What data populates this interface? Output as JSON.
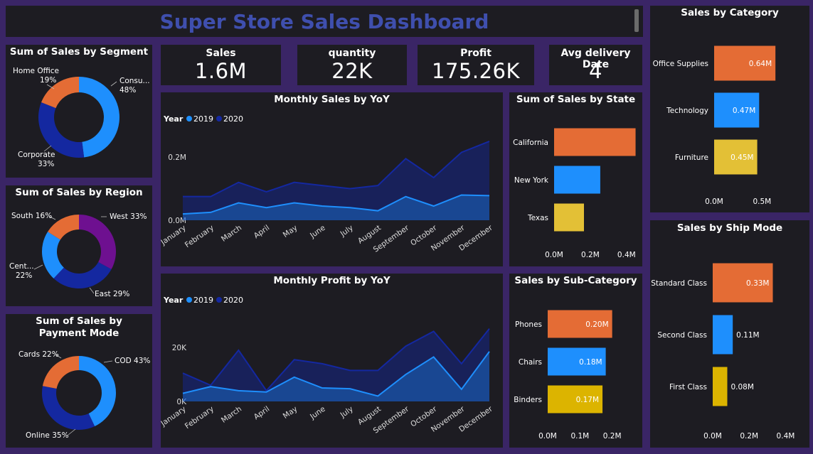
{
  "dashboard": {
    "title": "Super Store Sales Dashboard"
  },
  "kpis": [
    {
      "label": "Sales",
      "value": "1.6M"
    },
    {
      "label": "quantity",
      "value": "22K"
    },
    {
      "label": "Profit",
      "value": "175.26K"
    },
    {
      "label": "Avg delivery Date",
      "value": "4"
    }
  ],
  "colors": {
    "blue": "#1e8ffd",
    "darkblue": "#1428a0",
    "orange": "#e46c35",
    "purple": "#6e1090",
    "yellow": "#e3c036",
    "gold": "#dcb400"
  },
  "chart_data": [
    {
      "id": "segment",
      "type": "pie",
      "title": "Sum of Sales by Segment",
      "slices": [
        {
          "label": "Consu...",
          "pct": "48%",
          "value": 48,
          "color": "#1e8ffd"
        },
        {
          "label": "Corporate",
          "pct": "33%",
          "value": 33,
          "color": "#1428a0"
        },
        {
          "label": "Home Office",
          "pct": "19%",
          "value": 19,
          "color": "#e46c35"
        }
      ]
    },
    {
      "id": "region",
      "type": "pie",
      "title": "Sum of Sales by Region",
      "slices": [
        {
          "label": "West",
          "pct": "33%",
          "value": 33,
          "color": "#6e1090"
        },
        {
          "label": "East",
          "pct": "29%",
          "value": 29,
          "color": "#1428a0"
        },
        {
          "label": "Cent...",
          "pct": "22%",
          "value": 22,
          "color": "#1e8ffd"
        },
        {
          "label": "South",
          "pct": "16%",
          "value": 16,
          "color": "#e46c35"
        }
      ]
    },
    {
      "id": "payment",
      "type": "pie",
      "title": "Sum of Sales by Payment Mode",
      "slices": [
        {
          "label": "COD",
          "pct": "43%",
          "value": 43,
          "color": "#1e8ffd"
        },
        {
          "label": "Online",
          "pct": "35%",
          "value": 35,
          "color": "#1428a0"
        },
        {
          "label": "Cards",
          "pct": "22%",
          "value": 22,
          "color": "#e46c35"
        }
      ]
    },
    {
      "id": "monthly_sales",
      "type": "area",
      "title": "Monthly Sales by YoY",
      "legend_title": "Year",
      "categories": [
        "January",
        "February",
        "March",
        "April",
        "May",
        "June",
        "July",
        "August",
        "September",
        "October",
        "November",
        "December"
      ],
      "series": [
        {
          "name": "2020",
          "color": "#1428a0",
          "values": [
            0.075,
            0.075,
            0.12,
            0.09,
            0.12,
            0.11,
            0.1,
            0.11,
            0.195,
            0.135,
            0.215,
            0.25
          ]
        },
        {
          "name": "2019",
          "color": "#1e8ffd",
          "values": [
            0.02,
            0.025,
            0.055,
            0.04,
            0.055,
            0.045,
            0.04,
            0.03,
            0.075,
            0.045,
            0.08,
            0.078
          ]
        }
      ],
      "yticks": [
        {
          "v": 0,
          "label": "0.0M"
        },
        {
          "v": 0.2,
          "label": "0.2M"
        }
      ],
      "ylim": [
        0,
        0.27
      ]
    },
    {
      "id": "monthly_profit",
      "type": "area",
      "title": "Monthly Profit by YoY",
      "legend_title": "Year",
      "categories": [
        "January",
        "February",
        "March",
        "April",
        "May",
        "June",
        "July",
        "August",
        "September",
        "October",
        "November",
        "December"
      ],
      "series": [
        {
          "name": "2020",
          "color": "#1428a0",
          "values": [
            10500,
            6000,
            19000,
            4000,
            15500,
            14000,
            11500,
            11500,
            20500,
            26000,
            14000,
            27000
          ]
        },
        {
          "name": "2019",
          "color": "#1e8ffd",
          "values": [
            3000,
            5500,
            4000,
            3500,
            9000,
            5000,
            4700,
            2000,
            10000,
            16500,
            4500,
            18500
          ]
        }
      ],
      "yticks": [
        {
          "v": 0,
          "label": "0K"
        },
        {
          "v": 20000,
          "label": "20K"
        }
      ],
      "ylim": [
        0,
        29000
      ]
    },
    {
      "id": "state",
      "type": "bar",
      "title": "Sum of Sales by State",
      "categories": [
        "California",
        "New York",
        "Texas"
      ],
      "values": [
        0.45,
        0.255,
        0.165
      ],
      "value_labels": [
        "",
        "",
        ""
      ],
      "colors": [
        "#e46c35",
        "#1e8ffd",
        "#e3c036"
      ],
      "xticks": [
        {
          "v": 0,
          "label": "0.0M"
        },
        {
          "v": 0.2,
          "label": "0.2M"
        },
        {
          "v": 0.4,
          "label": "0.4M"
        }
      ],
      "xlim": [
        0,
        0.44
      ]
    },
    {
      "id": "subcategory",
      "type": "bar",
      "title": "Sales by Sub-Category",
      "categories": [
        "Phones",
        "Chairs",
        "Binders"
      ],
      "values": [
        0.2,
        0.18,
        0.17
      ],
      "value_labels": [
        "0.20M",
        "0.18M",
        "0.17M"
      ],
      "colors": [
        "#e46c35",
        "#1e8ffd",
        "#dcb400"
      ],
      "xticks": [
        {
          "v": 0,
          "label": "0.0M"
        },
        {
          "v": 0.1,
          "label": "0.1M"
        },
        {
          "v": 0.2,
          "label": "0.2M"
        }
      ],
      "xlim": [
        0,
        0.225
      ]
    },
    {
      "id": "category",
      "type": "bar",
      "title": "Sales by Category",
      "categories": [
        "Office Supplies",
        "Technology",
        "Furniture"
      ],
      "values": [
        0.64,
        0.47,
        0.45
      ],
      "value_labels": [
        "0.64M",
        "0.47M",
        "0.45M"
      ],
      "colors": [
        "#e46c35",
        "#1e8ffd",
        "#e3c036"
      ],
      "xticks": [
        {
          "v": 0,
          "label": "0.0M"
        },
        {
          "v": 0.5,
          "label": "0.5M"
        }
      ],
      "xlim": [
        0,
        0.75
      ]
    },
    {
      "id": "shipmode",
      "type": "bar",
      "title": "Sales by Ship Mode",
      "categories": [
        "Standard Class",
        "Second Class",
        "First Class"
      ],
      "values": [
        0.33,
        0.11,
        0.08
      ],
      "value_labels": [
        "0.33M",
        "0.11M",
        "0.08M"
      ],
      "colors": [
        "#e46c35",
        "#1e8ffd",
        "#dcb400"
      ],
      "xticks": [
        {
          "v": 0,
          "label": "0.0M"
        },
        {
          "v": 0.2,
          "label": "0.2M"
        },
        {
          "v": 0.4,
          "label": "0.4M"
        }
      ],
      "xlim": [
        0,
        0.41
      ]
    }
  ]
}
